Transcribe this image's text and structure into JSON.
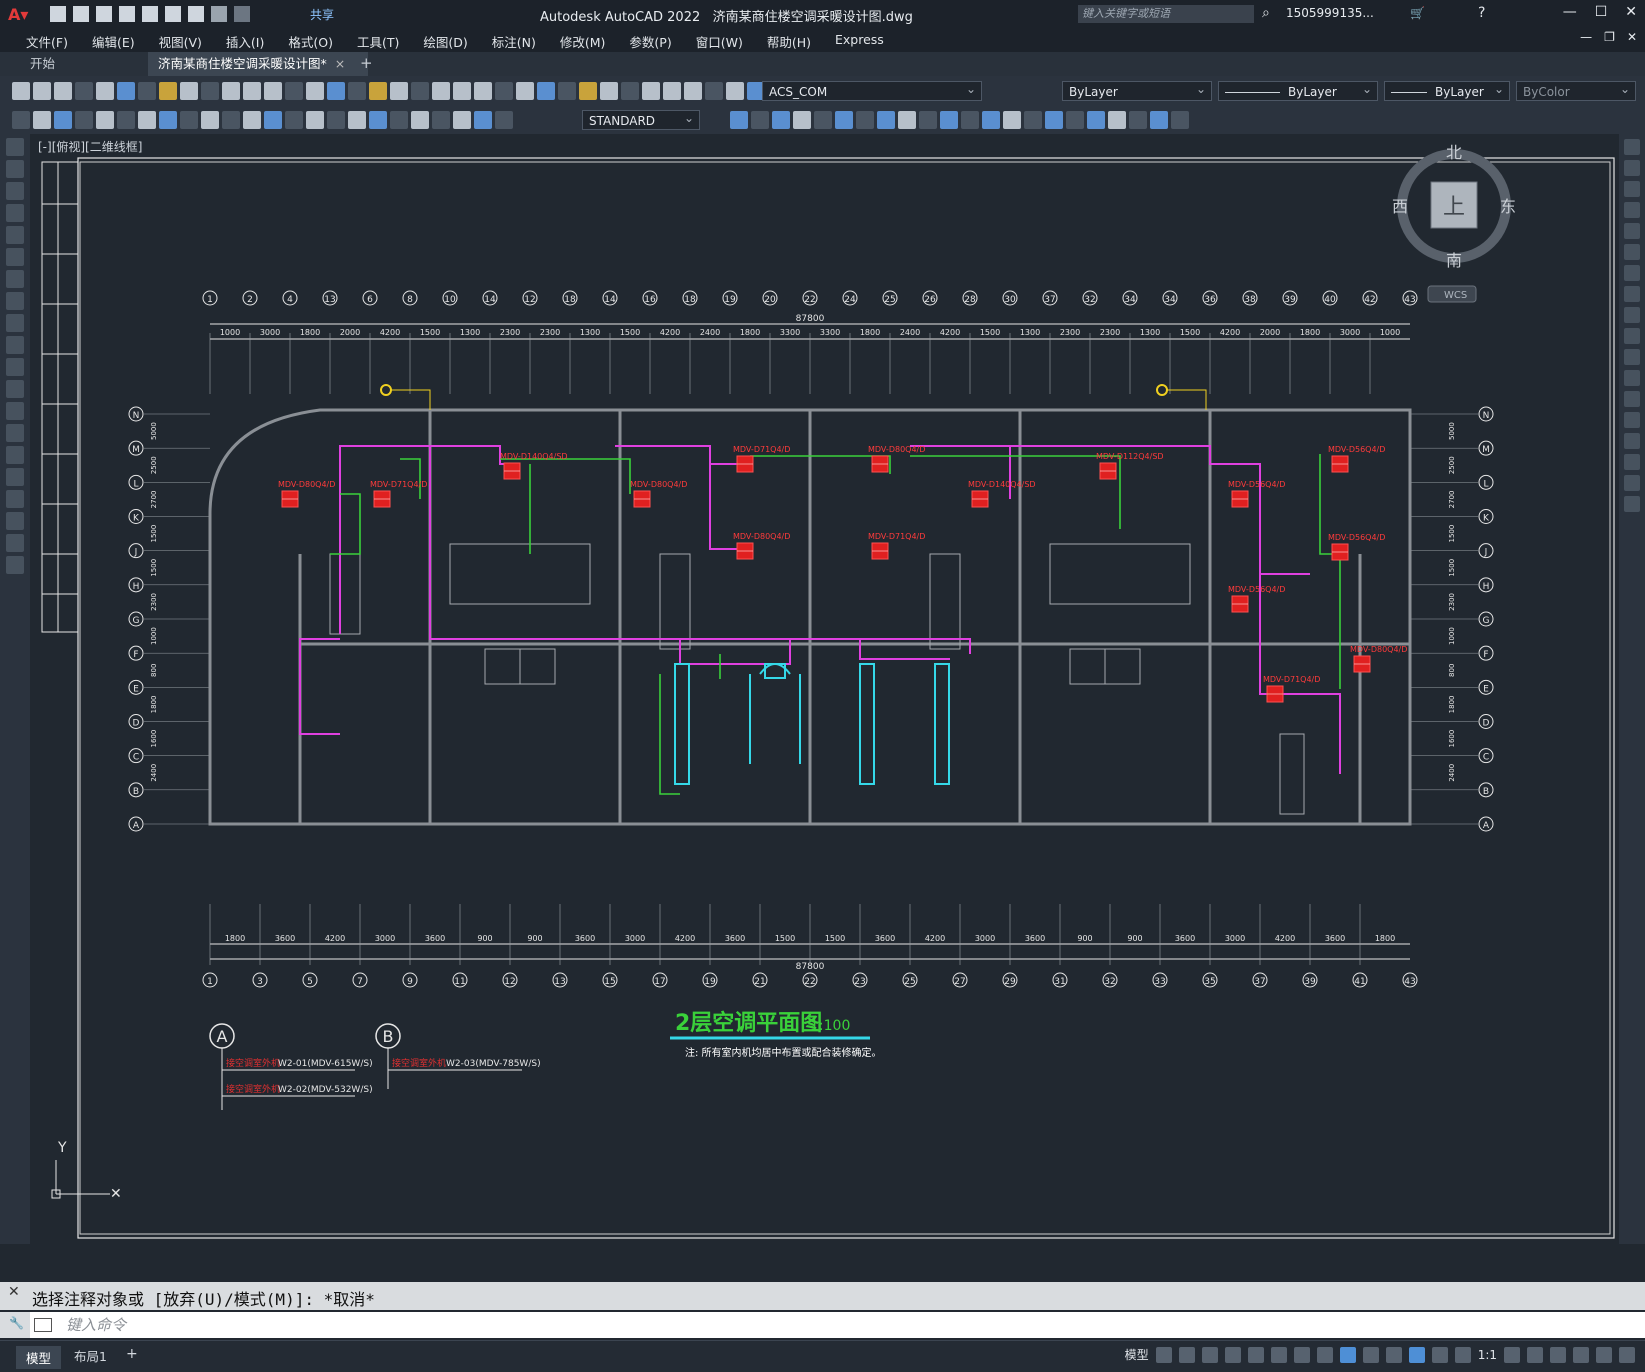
{
  "app": {
    "name": "Autodesk AutoCAD 2022",
    "file_title": "济南某商住楼空调采暖设计图.dwg",
    "share_label": "共享",
    "search_placeholder": "键入关键字或短语",
    "user": "1505999135...",
    "accent_color": "#e23a3a"
  },
  "menu": [
    "文件(F)",
    "编辑(E)",
    "视图(V)",
    "插入(I)",
    "格式(O)",
    "工具(T)",
    "绘图(D)",
    "标注(N)",
    "修改(M)",
    "参数(P)",
    "窗口(W)",
    "帮助(H)",
    "Express"
  ],
  "tabs": {
    "start": "开始",
    "active": "济南某商住楼空调采暖设计图*",
    "close": "×",
    "add": "+"
  },
  "toolbar": {
    "layer": "ACS_COM",
    "color": "ByLayer",
    "linetype": "ByLayer",
    "lineweight": "ByLayer",
    "plotstyle": "ByColor",
    "textstyle": "STANDARD"
  },
  "viewport": {
    "label": "[-][俯视][二维线框]",
    "viewcube": {
      "north": "北",
      "south": "南",
      "east": "东",
      "west": "西",
      "top": "上",
      "wcs": "WCS"
    },
    "ucs_y": "Y"
  },
  "drawing": {
    "title": "2层空调平面图",
    "scale": "1:100",
    "note": "注: 所有室内机均居中布置或配合装修确定。",
    "top_axes": [
      "1",
      "2",
      "4",
      "13",
      "6",
      "8",
      "10",
      "14",
      "12",
      "18",
      "14",
      "16",
      "18",
      "19",
      "20",
      "22",
      "24",
      "25",
      "26",
      "28",
      "30",
      "37",
      "32",
      "34",
      "34",
      "36",
      "38",
      "39",
      "40",
      "42",
      "43"
    ],
    "top_dims": [
      "1000",
      "3000",
      "1800",
      "2000",
      "4200",
      "1500",
      "1300",
      "2300",
      "2300",
      "1300",
      "1500",
      "4200",
      "2400",
      "1800",
      "3300",
      "3300",
      "1800",
      "2400",
      "4200",
      "1500",
      "1300",
      "2300",
      "2300",
      "1300",
      "1500",
      "4200",
      "2000",
      "1800",
      "3000",
      "1000"
    ],
    "top_total": "87800",
    "bottom_axes": [
      "1",
      "3",
      "5",
      "7",
      "9",
      "11",
      "12",
      "13",
      "15",
      "17",
      "19",
      "21",
      "22",
      "23",
      "25",
      "27",
      "29",
      "31",
      "32",
      "33",
      "35",
      "37",
      "39",
      "41",
      "43"
    ],
    "bottom_dims": [
      "1800",
      "3600",
      "4200",
      "3000",
      "3600",
      "900",
      "900",
      "3600",
      "3000",
      "4200",
      "3600",
      "1500",
      "1500",
      "3600",
      "4200",
      "3000",
      "3600",
      "900",
      "900",
      "3600",
      "3000",
      "4200",
      "3600",
      "1800"
    ],
    "bottom_total": "87800",
    "row_axes": [
      "N",
      "M",
      "L",
      "K",
      "J",
      "H",
      "G",
      "F",
      "E",
      "D",
      "C",
      "B",
      "A"
    ],
    "row_dims": [
      "5000",
      "2500",
      "2700",
      "1500",
      "1500",
      "2300",
      "1000",
      "800",
      "1800",
      "1600",
      "2400"
    ],
    "indoor_units": [
      "MDV-D80Q4/D",
      "MDV-D71Q4/D",
      "MDV-D140Q4/SD",
      "MDV-D80Q4/D",
      "MDV-D71Q4/D",
      "MDV-D80Q4/D",
      "MDV-D80Q4/D",
      "MDV-D71Q4/D",
      "MDV-D140Q4/SD",
      "MDV-D112Q4/SD",
      "MDV-D56Q4/D",
      "MDV-D56Q4/D",
      "MDV-D56Q4/D",
      "MDV-D56Q4/D",
      "MDV-D80Q4/D",
      "MDV-D71Q4/D"
    ],
    "legend_a": {
      "mark": "A",
      "lines": [
        "W2-01(MDV-615W/S)",
        "W2-02(MDV-532W/S)"
      ],
      "prefix": "接空调室外机"
    },
    "legend_b": {
      "mark": "B",
      "lines": [
        "W2-03(MDV-785W/S)"
      ],
      "prefix": "接空调室外机"
    }
  },
  "command": {
    "history": "选择注释对象或 [放弃(U)/模式(M)]: *取消*",
    "placeholder": "键入命令"
  },
  "layouts": {
    "model": "模型",
    "layout1": "布局1",
    "add": "+"
  },
  "status": {
    "model_label": "模型",
    "scale": "1:1"
  }
}
